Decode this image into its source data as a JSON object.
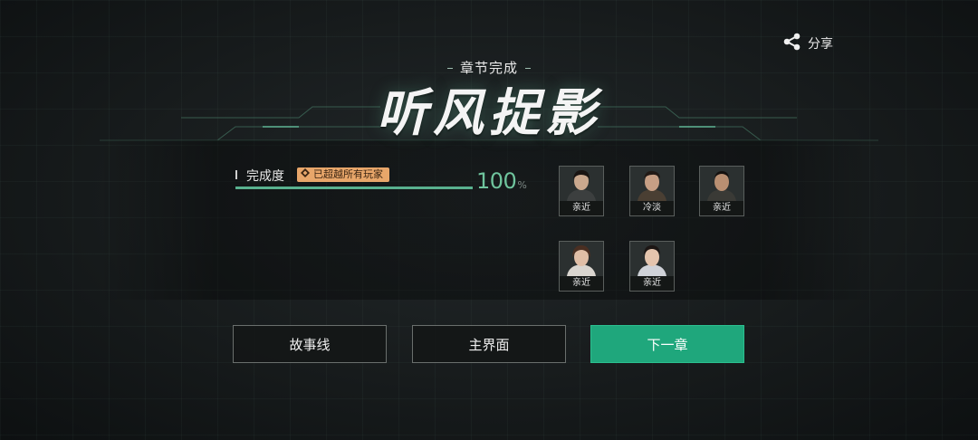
{
  "header": {
    "share_label": "分享",
    "share_icon": "share-icon"
  },
  "chapter": {
    "subtitle": "章节完成",
    "title": "听风捉影"
  },
  "completion": {
    "label": "完成度",
    "badge": "已超越所有玩家",
    "value": "100",
    "unit": "%",
    "progress": 1.0
  },
  "characters": [
    {
      "relation": "亲近"
    },
    {
      "relation": "冷淡"
    },
    {
      "relation": "亲近"
    },
    {
      "relation": "亲近"
    },
    {
      "relation": "亲近"
    }
  ],
  "buttons": {
    "storyline": "故事线",
    "main_menu": "主界面",
    "next_chapter": "下一章"
  },
  "colors": {
    "accent": "#1fa77c",
    "progress": "#59b18f",
    "badge": "#e8a66a"
  }
}
